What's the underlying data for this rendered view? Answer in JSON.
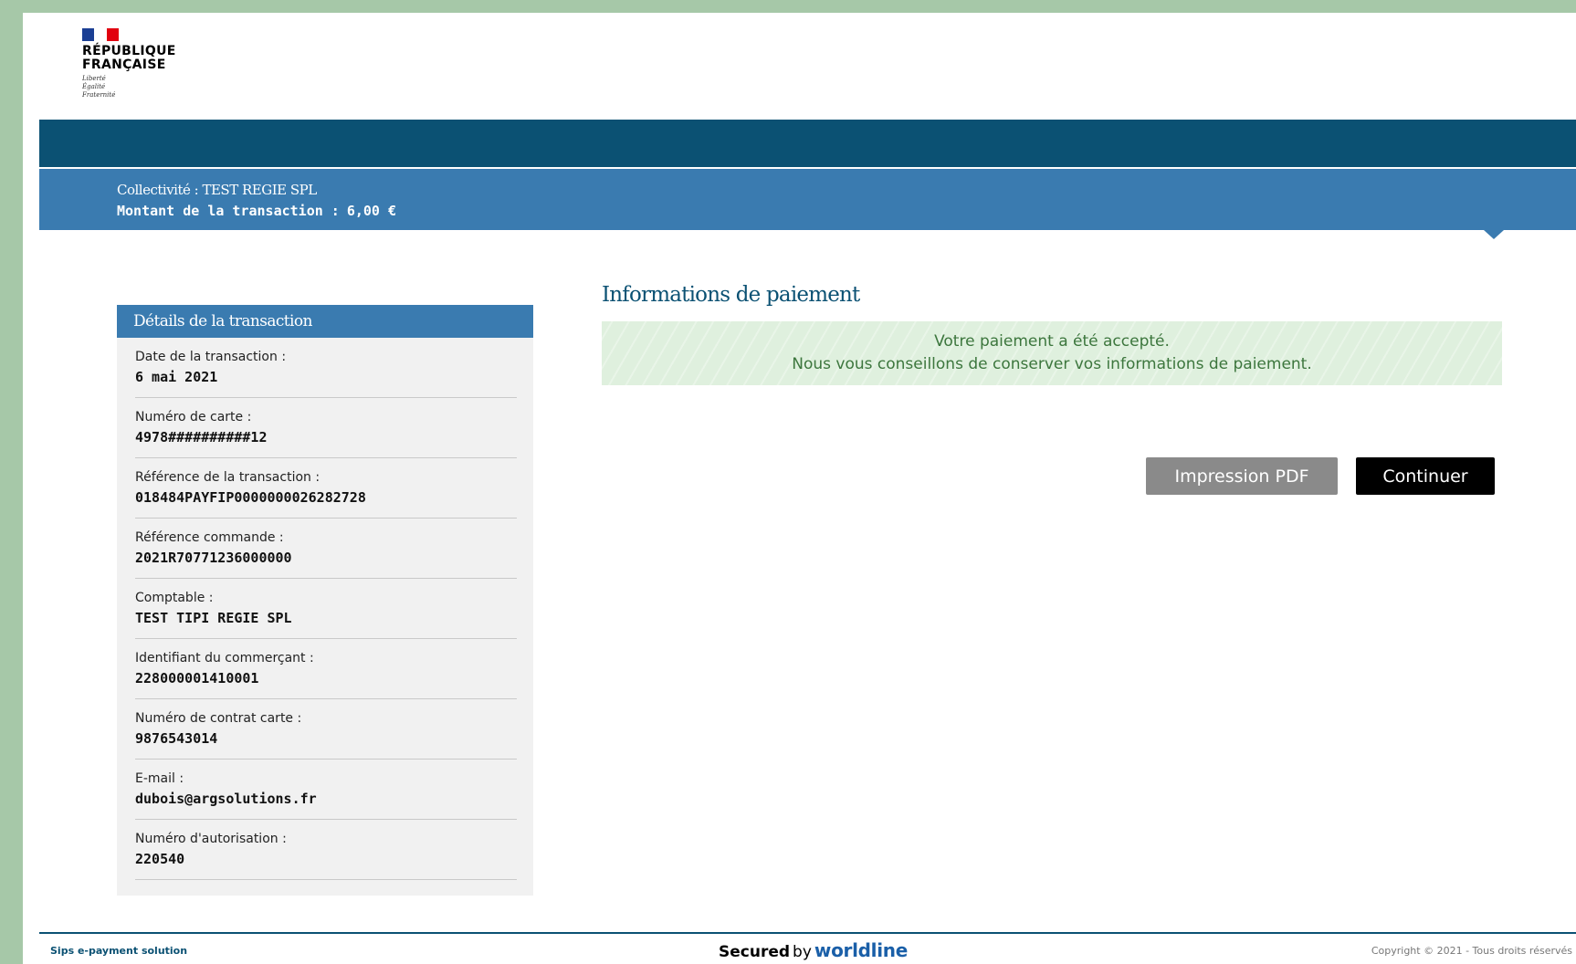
{
  "header": {
    "logo_title_line1": "RÉPUBLIQUE",
    "logo_title_line2": "FRANÇAISE",
    "logo_motto_line1": "Liberté",
    "logo_motto_line2": "Égalité",
    "logo_motto_line3": "Fraternité"
  },
  "banner": {
    "collectivite": "Collectivité : TEST REGIE SPL",
    "montant_label": "Montant de la transaction :",
    "montant_value": "6,00 €"
  },
  "details": {
    "title": "Détails de la transaction",
    "fields": [
      {
        "label": "Date de la transaction :",
        "value": "6 mai 2021"
      },
      {
        "label": "Numéro de carte :",
        "value": "4978##########12"
      },
      {
        "label": "Référence de la transaction :",
        "value": "018484PAYFIP0000000026282728"
      },
      {
        "label": "Référence commande :",
        "value": "2021R70771236000000"
      },
      {
        "label": "Comptable :",
        "value": "TEST TIPI REGIE SPL"
      },
      {
        "label": "Identifiant du commerçant :",
        "value": "228000001410001"
      },
      {
        "label": "Numéro de contrat carte :",
        "value": "9876543014"
      },
      {
        "label": "E-mail :",
        "value": "dubois@argsolutions.fr"
      },
      {
        "label": "Numéro d'autorisation :",
        "value": "220540"
      }
    ]
  },
  "main": {
    "title": "Informations de paiement",
    "notice_line1": "Votre paiement a été accepté.",
    "notice_line2": "Nous vous conseillons de conserver vos informations de paiement.",
    "pdf_button": "Impression PDF",
    "continue_button": "Continuer"
  },
  "footer": {
    "left": "Sips e-payment solution",
    "secured": "Secured",
    "by": "by",
    "brand": "worldline",
    "copyright": "Copyright © 2021 - Tous droits réservés"
  },
  "colors": {
    "dark_band": "#0b5173",
    "light_band": "#3a7bb0",
    "success_text": "#3c763d",
    "background_frame": "#a6c8a8"
  }
}
